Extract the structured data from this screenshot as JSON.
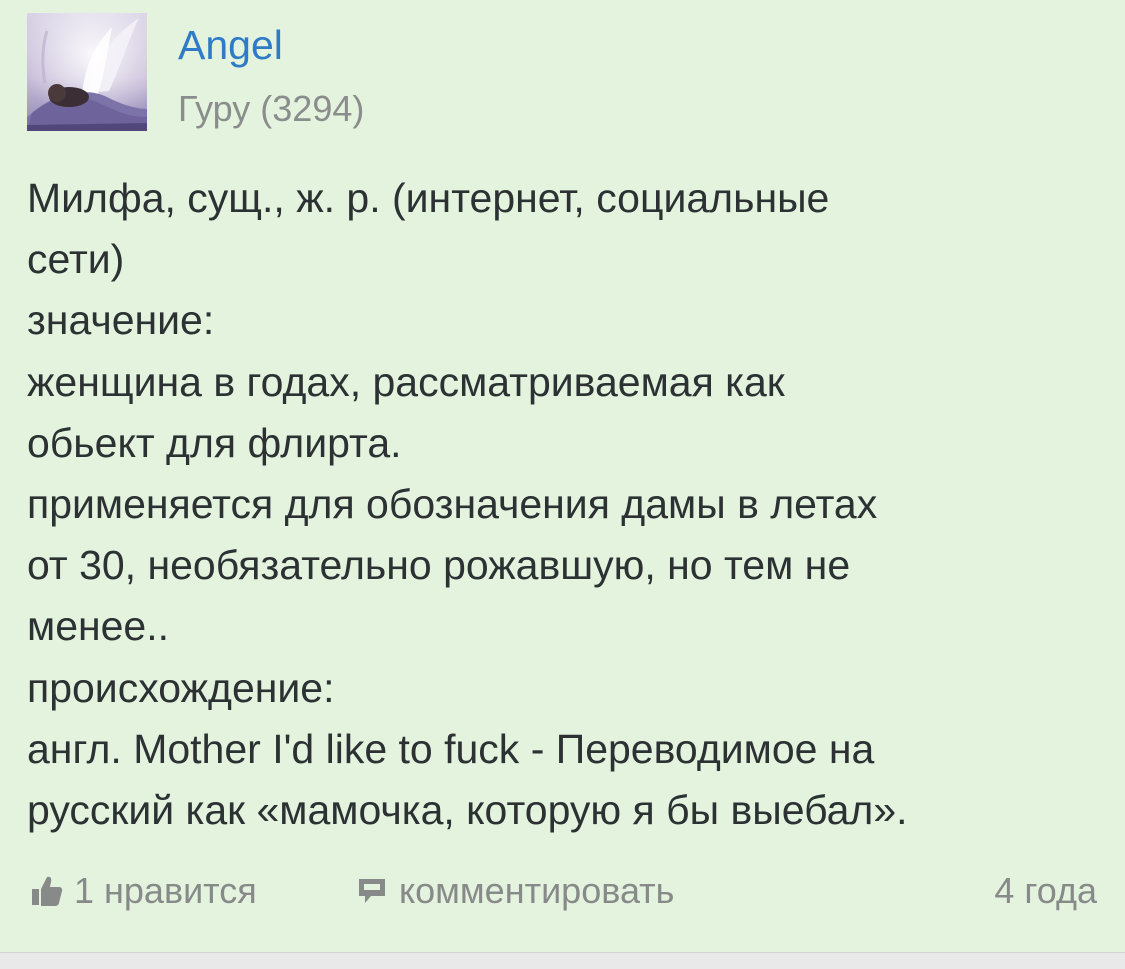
{
  "user": {
    "name": "Angel",
    "rank": "Гуру (3294)"
  },
  "post": {
    "lines": [
      "Милфа, сущ., ж. р. (интернет, социальные",
      "сети)",
      "значение:",
      "женщина в годах, рассматриваемая как",
      "обьект для флирта.",
      "применяется для обозначения дамы в летах",
      "от 30, необязательно рожавшую, но тем не",
      "менее..",
      "происхождение:",
      "англ. Mother I'd like to fuck - Переводимое на",
      "русский как «мамочка, которую я бы выебал»."
    ]
  },
  "footer": {
    "like_label": "1 нравится",
    "comment_label": "комментировать",
    "age": "4 года"
  },
  "icons": {
    "like": "thumbs-up-icon",
    "comment": "comment-icon"
  },
  "colors": {
    "background": "#e4f3de",
    "username": "#2f7bc6",
    "text": "#2c3133",
    "muted": "#878a89"
  }
}
